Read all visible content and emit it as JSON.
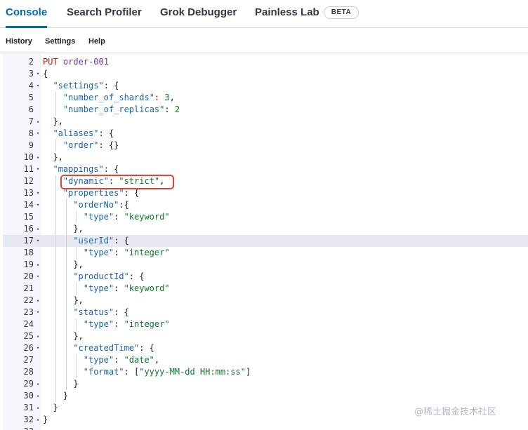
{
  "tabs": [
    {
      "label": "Console",
      "active": true
    },
    {
      "label": "Search Profiler",
      "active": false
    },
    {
      "label": "Grok Debugger",
      "active": false
    },
    {
      "label": "Painless Lab",
      "active": false
    }
  ],
  "beta_badge": "BETA",
  "subnav": [
    "History",
    "Settings",
    "Help"
  ],
  "editor": {
    "active_line": 17,
    "highlight_line": 12,
    "lines": [
      {
        "n": 2,
        "fold": "",
        "indent": 0,
        "code": [
          [
            "kw",
            "PUT "
          ],
          [
            "url",
            "order-001"
          ]
        ]
      },
      {
        "n": 3,
        "fold": "▾",
        "indent": 0,
        "code": [
          [
            "punc",
            "{"
          ]
        ]
      },
      {
        "n": 4,
        "fold": "▾",
        "indent": 1,
        "code": [
          [
            "key",
            "\"settings\""
          ],
          [
            "punc",
            ": {"
          ]
        ]
      },
      {
        "n": 5,
        "fold": "",
        "indent": 2,
        "code": [
          [
            "key",
            "\"number_of_shards\""
          ],
          [
            "punc",
            ": "
          ],
          [
            "num",
            "3"
          ],
          [
            "punc",
            ","
          ]
        ]
      },
      {
        "n": 6,
        "fold": "",
        "indent": 2,
        "code": [
          [
            "key",
            "\"number_of_replicas\""
          ],
          [
            "punc",
            ": "
          ],
          [
            "num",
            "2"
          ]
        ]
      },
      {
        "n": 7,
        "fold": "▴",
        "indent": 1,
        "code": [
          [
            "punc",
            "},"
          ]
        ]
      },
      {
        "n": 8,
        "fold": "▾",
        "indent": 1,
        "code": [
          [
            "key",
            "\"aliases\""
          ],
          [
            "punc",
            ": {"
          ]
        ]
      },
      {
        "n": 9,
        "fold": "",
        "indent": 2,
        "code": [
          [
            "key",
            "\"order\""
          ],
          [
            "punc",
            ": {}"
          ]
        ]
      },
      {
        "n": 10,
        "fold": "▴",
        "indent": 1,
        "code": [
          [
            "punc",
            "},"
          ]
        ]
      },
      {
        "n": 11,
        "fold": "▾",
        "indent": 1,
        "code": [
          [
            "key",
            "\"mappings\""
          ],
          [
            "punc",
            ": {"
          ]
        ]
      },
      {
        "n": 12,
        "fold": "",
        "indent": 2,
        "code": [
          [
            "key",
            "\"dynamic\""
          ],
          [
            "punc",
            ": "
          ],
          [
            "str",
            "\"strict\""
          ],
          [
            "punc",
            ","
          ]
        ]
      },
      {
        "n": 13,
        "fold": "▾",
        "indent": 2,
        "code": [
          [
            "key",
            "\"properties\""
          ],
          [
            "punc",
            ": {"
          ]
        ]
      },
      {
        "n": 14,
        "fold": "▾",
        "indent": 3,
        "code": [
          [
            "key",
            "\"orderNo\""
          ],
          [
            "punc",
            ":{"
          ]
        ]
      },
      {
        "n": 15,
        "fold": "",
        "indent": 4,
        "code": [
          [
            "key",
            "\"type\""
          ],
          [
            "punc",
            ": "
          ],
          [
            "str",
            "\"keyword\""
          ]
        ]
      },
      {
        "n": 16,
        "fold": "▴",
        "indent": 3,
        "code": [
          [
            "punc",
            "},"
          ]
        ]
      },
      {
        "n": 17,
        "fold": "▾",
        "indent": 3,
        "code": [
          [
            "key",
            "\"userId\""
          ],
          [
            "punc",
            ": {"
          ]
        ]
      },
      {
        "n": 18,
        "fold": "",
        "indent": 4,
        "code": [
          [
            "key",
            "\"type\""
          ],
          [
            "punc",
            ": "
          ],
          [
            "str",
            "\"integer\""
          ]
        ]
      },
      {
        "n": 19,
        "fold": "▴",
        "indent": 3,
        "code": [
          [
            "punc",
            "},"
          ]
        ]
      },
      {
        "n": 20,
        "fold": "▾",
        "indent": 3,
        "code": [
          [
            "key",
            "\"productId\""
          ],
          [
            "punc",
            ": {"
          ]
        ]
      },
      {
        "n": 21,
        "fold": "",
        "indent": 4,
        "code": [
          [
            "key",
            "\"type\""
          ],
          [
            "punc",
            ": "
          ],
          [
            "str",
            "\"keyword\""
          ]
        ]
      },
      {
        "n": 22,
        "fold": "▴",
        "indent": 3,
        "code": [
          [
            "punc",
            "},"
          ]
        ]
      },
      {
        "n": 23,
        "fold": "▾",
        "indent": 3,
        "code": [
          [
            "key",
            "\"status\""
          ],
          [
            "punc",
            ": {"
          ]
        ]
      },
      {
        "n": 24,
        "fold": "",
        "indent": 4,
        "code": [
          [
            "key",
            "\"type\""
          ],
          [
            "punc",
            ": "
          ],
          [
            "str",
            "\"integer\""
          ]
        ]
      },
      {
        "n": 25,
        "fold": "▴",
        "indent": 3,
        "code": [
          [
            "punc",
            "},"
          ]
        ]
      },
      {
        "n": 26,
        "fold": "▾",
        "indent": 3,
        "code": [
          [
            "key",
            "\"createdTime\""
          ],
          [
            "punc",
            ": {"
          ]
        ]
      },
      {
        "n": 27,
        "fold": "",
        "indent": 4,
        "code": [
          [
            "key",
            "\"type\""
          ],
          [
            "punc",
            ": "
          ],
          [
            "str",
            "\"date\""
          ],
          [
            "punc",
            ","
          ]
        ]
      },
      {
        "n": 28,
        "fold": "",
        "indent": 4,
        "code": [
          [
            "key",
            "\"format\""
          ],
          [
            "punc",
            ": ["
          ],
          [
            "str",
            "\"yyyy-MM-dd HH:mm:ss\""
          ],
          [
            "punc",
            "]"
          ]
        ]
      },
      {
        "n": 29,
        "fold": "▴",
        "indent": 3,
        "code": [
          [
            "punc",
            "}"
          ]
        ]
      },
      {
        "n": 30,
        "fold": "▴",
        "indent": 2,
        "code": [
          [
            "punc",
            "}"
          ]
        ]
      },
      {
        "n": 31,
        "fold": "▴",
        "indent": 1,
        "code": [
          [
            "punc",
            "}"
          ]
        ]
      },
      {
        "n": 32,
        "fold": "▴",
        "indent": 0,
        "code": [
          [
            "punc",
            "}"
          ]
        ]
      },
      {
        "n": 33,
        "fold": "",
        "indent": 0,
        "code": []
      }
    ]
  },
  "watermark": "@稀土掘金技术社区"
}
